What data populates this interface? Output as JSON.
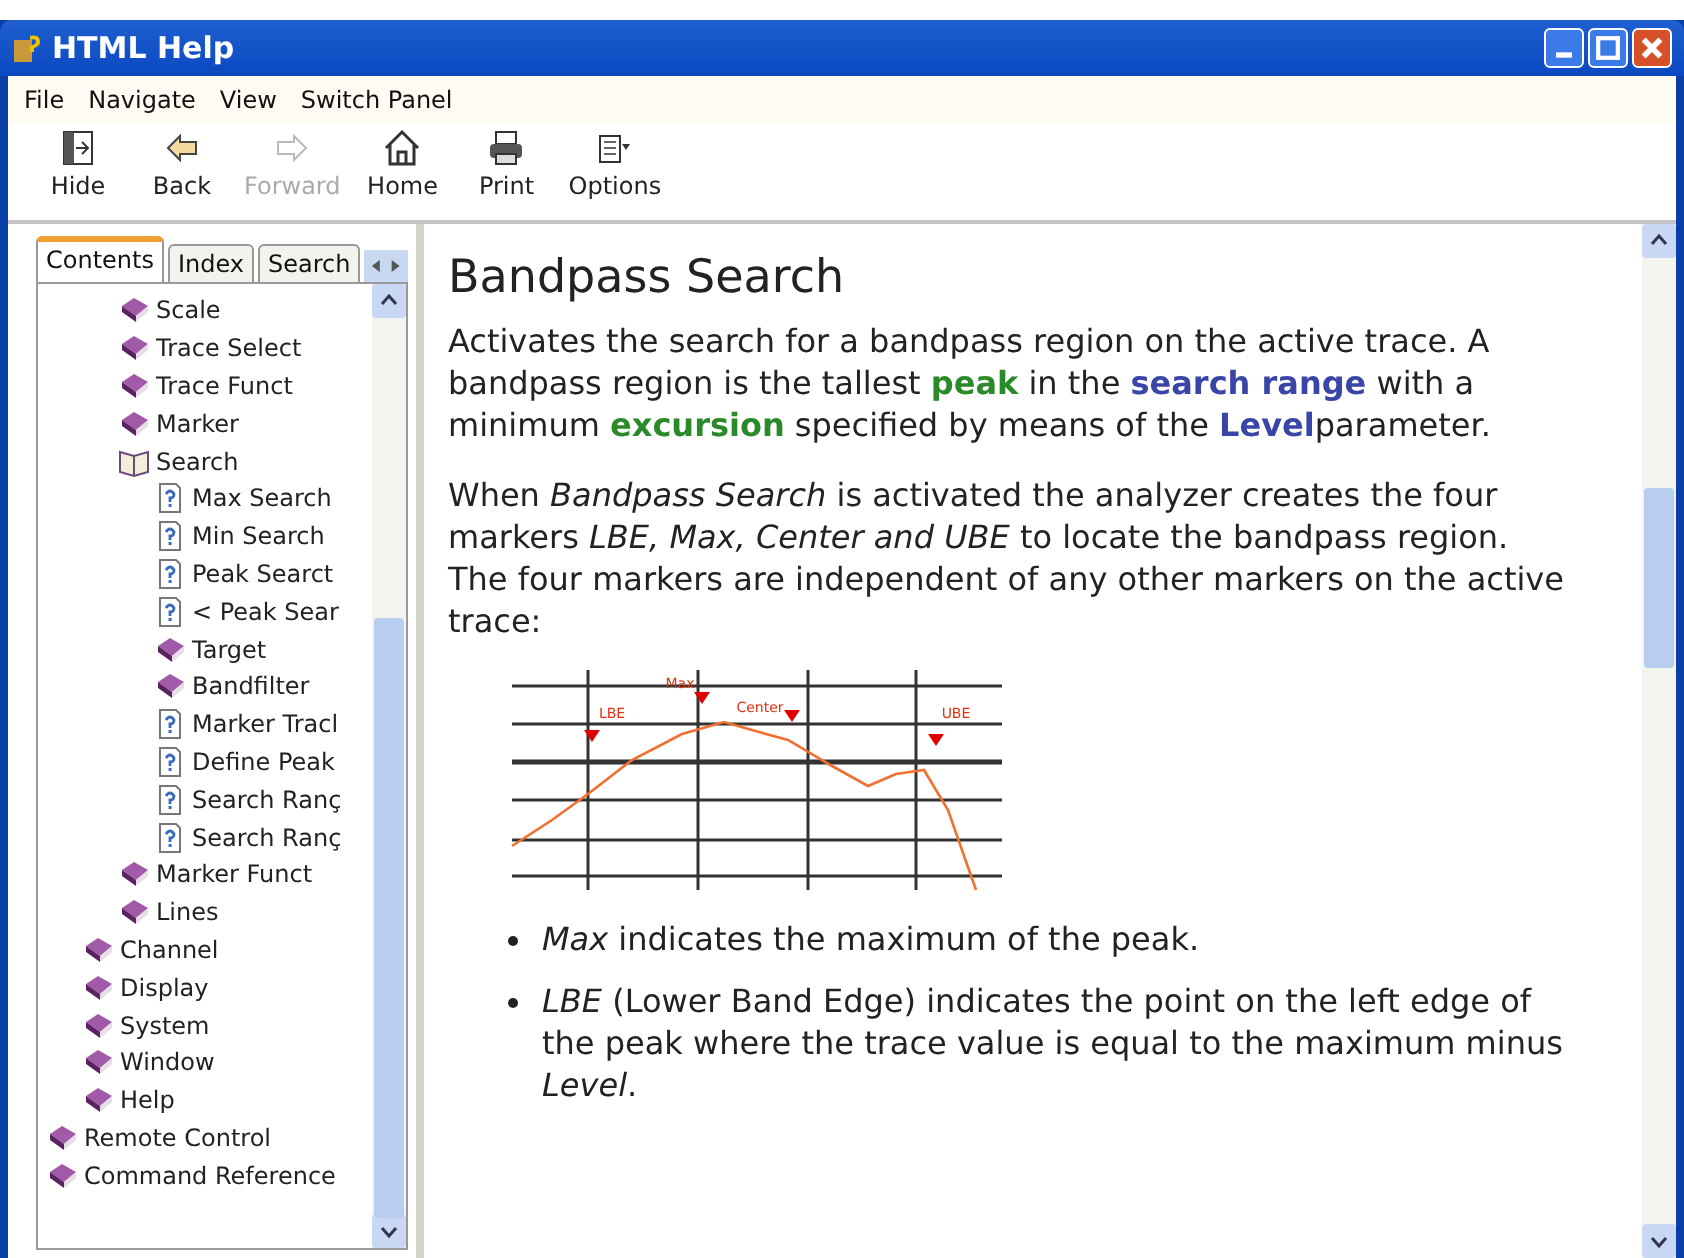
{
  "window": {
    "title": "HTML Help"
  },
  "menu": [
    "File",
    "Navigate",
    "View",
    "Switch Panel"
  ],
  "toolbar": [
    {
      "label": "Hide",
      "kind": "hide",
      "disabled": false
    },
    {
      "label": "Back",
      "kind": "back",
      "disabled": false
    },
    {
      "label": "Forward",
      "kind": "forward",
      "disabled": true
    },
    {
      "label": "Home",
      "kind": "home",
      "disabled": false
    },
    {
      "label": "Print",
      "kind": "print",
      "disabled": false
    },
    {
      "label": "Options",
      "kind": "options",
      "disabled": false
    }
  ],
  "tabs": [
    {
      "label": "Contents",
      "selected": true
    },
    {
      "label": "Index",
      "selected": false
    },
    {
      "label": "Search",
      "selected": false
    }
  ],
  "tree": [
    {
      "children": [
        {
          "children": [
            {
              "label": "Scale",
              "kind": "book",
              "expanded": false
            },
            {
              "label": "Trace Select",
              "kind": "book",
              "expanded": false
            },
            {
              "label": "Trace Funct",
              "kind": "book",
              "expanded": false
            },
            {
              "label": "Marker",
              "kind": "book",
              "expanded": false
            },
            {
              "label": "Search",
              "kind": "book",
              "expanded": true,
              "children": [
                {
                  "label": "Max Search",
                  "kind": "page"
                },
                {
                  "label": "Min Search",
                  "kind": "page"
                },
                {
                  "label": "Peak Searct",
                  "kind": "page"
                },
                {
                  "label": "< Peak Sear",
                  "kind": "page"
                },
                {
                  "label": "Target",
                  "kind": "book",
                  "expanded": false
                },
                {
                  "label": "Bandfilter",
                  "kind": "book",
                  "expanded": false
                },
                {
                  "label": "Marker Tracl",
                  "kind": "page"
                },
                {
                  "label": "Define Peak",
                  "kind": "page"
                },
                {
                  "label": "Search Ranç",
                  "kind": "page"
                },
                {
                  "label": "Search Ranç",
                  "kind": "page"
                }
              ]
            },
            {
              "label": "Marker Funct",
              "kind": "book",
              "expanded": false
            },
            {
              "label": "Lines",
              "kind": "book",
              "expanded": false
            }
          ]
        },
        {
          "label": "Channel",
          "kind": "book",
          "expanded": false
        },
        {
          "label": "Display",
          "kind": "book",
          "expanded": false
        },
        {
          "label": "System",
          "kind": "book",
          "expanded": false
        },
        {
          "label": "Window",
          "kind": "book",
          "expanded": false
        },
        {
          "label": "Help",
          "kind": "book",
          "expanded": false
        }
      ]
    },
    {
      "label": "Remote Control",
      "kind": "book",
      "expanded": false
    },
    {
      "label": "Command Reference",
      "kind": "book",
      "expanded": false
    }
  ],
  "article": {
    "heading": "Bandpass Search",
    "intro": [
      {
        "kind": "text",
        "text": "Activates the search for a bandpass region on the active trace. A bandpass region is the tallest "
      },
      {
        "kind": "term",
        "text": "peak"
      },
      {
        "kind": "text",
        "text": " in the "
      },
      {
        "kind": "link",
        "text": "search range"
      },
      {
        "kind": "text",
        "text": " with a minimum "
      },
      {
        "kind": "term",
        "text": "excursion"
      },
      {
        "kind": "text",
        "text": " specified by means of the "
      },
      {
        "kind": "link",
        "text": "Level"
      },
      {
        "kind": "text",
        "text": "parameter."
      }
    ],
    "paragraph": "When *Bandpass Search* is activated the analyzer creates the four markers *LBE, Max, Center and UBE* to locate the bandpass region. The four markers are independent of any other markers on the active trace:",
    "diagram": {
      "markers": [
        "LBE",
        "Max",
        "Center",
        "UBE"
      ]
    },
    "bullets": [
      "*Max* indicates the maximum of the peak.",
      "*LBE* (Lower Band Edge) indicates the point on the left edge of the peak where the trace value is equal to the maximum minus *Level*."
    ]
  }
}
